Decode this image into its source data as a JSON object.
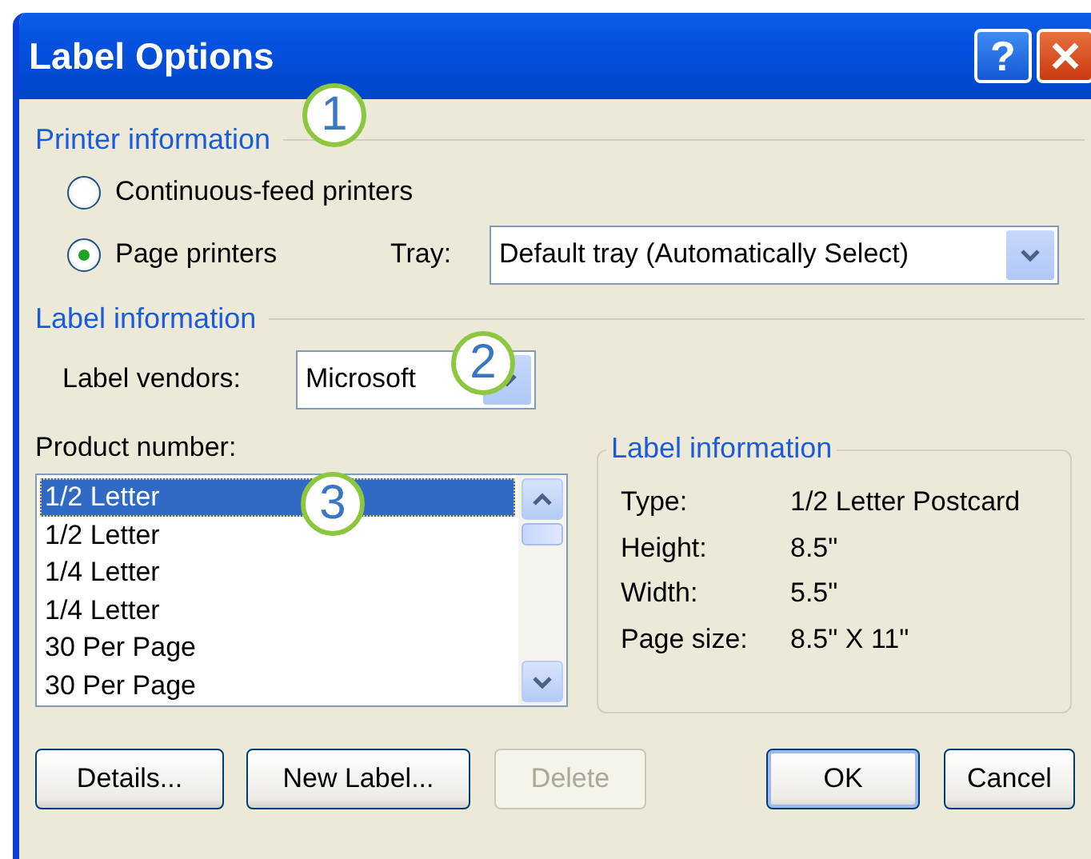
{
  "window": {
    "title": "Label Options",
    "help": "?"
  },
  "printer_information": {
    "heading": "Printer information",
    "options": [
      {
        "label": "Continuous-feed printers",
        "selected": false
      },
      {
        "label": "Page printers",
        "selected": true
      }
    ],
    "tray": {
      "label": "Tray:",
      "value": "Default tray (Automatically Select)"
    }
  },
  "label_information": {
    "heading": "Label information",
    "vendors": {
      "label": "Label vendors:",
      "value": "Microsoft"
    }
  },
  "product_number": {
    "label": "Product number:",
    "items": [
      {
        "label": "1/2 Letter",
        "selected": true
      },
      {
        "label": "1/2 Letter",
        "selected": false
      },
      {
        "label": "1/4 Letter",
        "selected": false
      },
      {
        "label": "1/4 Letter",
        "selected": false
      },
      {
        "label": "30 Per Page",
        "selected": false
      },
      {
        "label": "30 Per Page",
        "selected": false
      }
    ]
  },
  "details": {
    "heading": "Label information",
    "rows": [
      {
        "name": "Type:",
        "value": "1/2 Letter Postcard"
      },
      {
        "name": "Height:",
        "value": "8.5\""
      },
      {
        "name": "Width:",
        "value": "5.5\""
      },
      {
        "name": "Page size:",
        "value": "8.5\" X 11\""
      }
    ]
  },
  "buttons": [
    {
      "label": "Details...",
      "disabled": false,
      "default": false
    },
    {
      "label": "New Label...",
      "disabled": false,
      "default": false
    },
    {
      "label": "Delete",
      "disabled": true,
      "default": false
    },
    {
      "label": "OK",
      "disabled": false,
      "default": true
    },
    {
      "label": "Cancel",
      "disabled": false,
      "default": false
    }
  ],
  "callouts": [
    "1",
    "2",
    "3"
  ]
}
